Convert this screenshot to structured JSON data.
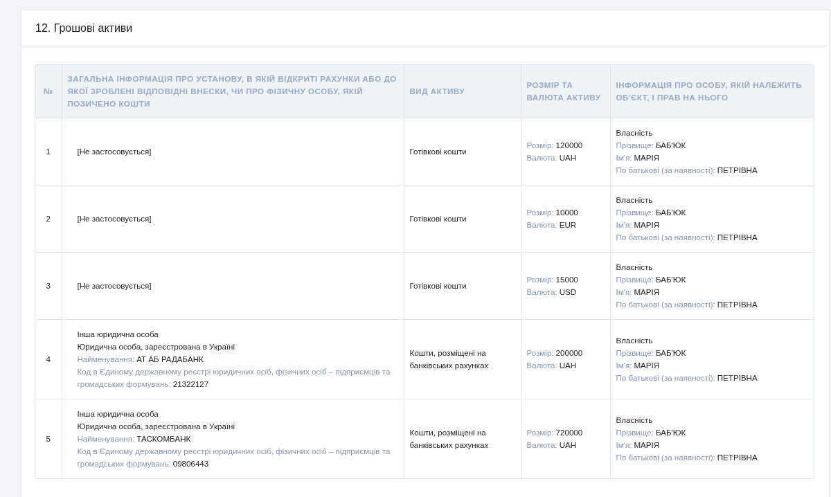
{
  "section": {
    "title": "12. Грошові активи"
  },
  "table": {
    "columns": [
      "№",
      "ЗАГАЛЬНА ІНФОРМАЦІЯ ПРО УСТАНОВУ, В ЯКІЙ ВІДКРИТІ РАХУНКИ АБО ДО ЯКОЇ ЗРОБЛЕНІ ВІДПОВІДНІ ВНЕСКИ, ЧИ ПРО ФІЗИЧНУ ОСОБУ, ЯКІЙ ПОЗИЧЕНО КОШТИ",
      "ВИД АКТИВУ",
      "РОЗМІР ТА ВАЛЮТА АКТИВУ",
      "ІНФОРМАЦІЯ ПРО ОСОБУ, ЯКІЙ НАЛЕЖИТЬ ОБ'ЄКТ, І ПРАВ НА НЬОГО"
    ],
    "rows": [
      {
        "number": "1",
        "institution": [
          {
            "value": "[Не застосовується]"
          }
        ],
        "asset_type": "Готівкові кошти",
        "amount": [
          {
            "label": "Розмір:",
            "value": "120000"
          },
          {
            "label": "Валюта:",
            "value": "UAH"
          }
        ],
        "owner": [
          {
            "value": "Власність"
          },
          {
            "label": "Прізвище:",
            "value": "БАБ'ЮК"
          },
          {
            "label": "Ім'я:",
            "value": "МАРІЯ"
          },
          {
            "label": "По батькові (за наявності):",
            "value": "ПЕТРІВНА"
          }
        ]
      },
      {
        "number": "2",
        "institution": [
          {
            "value": "[Не застосовується]"
          }
        ],
        "asset_type": "Готівкові кошти",
        "amount": [
          {
            "label": "Розмір:",
            "value": "10000"
          },
          {
            "label": "Валюта:",
            "value": "EUR"
          }
        ],
        "owner": [
          {
            "value": "Власність"
          },
          {
            "label": "Прізвище:",
            "value": "БАБ'ЮК"
          },
          {
            "label": "Ім'я:",
            "value": "МАРІЯ"
          },
          {
            "label": "По батькові (за наявності):",
            "value": "ПЕТРІВНА"
          }
        ]
      },
      {
        "number": "3",
        "institution": [
          {
            "value": "[Не застосовується]"
          }
        ],
        "asset_type": "Готівкові кошти",
        "amount": [
          {
            "label": "Розмір:",
            "value": "15000"
          },
          {
            "label": "Валюта:",
            "value": "USD"
          }
        ],
        "owner": [
          {
            "value": "Власність"
          },
          {
            "label": "Прізвище:",
            "value": "БАБ'ЮК"
          },
          {
            "label": "Ім'я:",
            "value": "МАРІЯ"
          },
          {
            "label": "По батькові (за наявності):",
            "value": "ПЕТРІВНА"
          }
        ]
      },
      {
        "number": "4",
        "institution": [
          {
            "value": "Інша юридична особа"
          },
          {
            "value": "Юридична особа, зареєстрована в Україні"
          },
          {
            "label": "Найменування:",
            "value": "АТ АБ РАДАБАНК"
          },
          {
            "label": "Код в Єдиному державному реєстрі юридичних осіб, фізичних осіб – підприємців та громадських формувань:",
            "value": "21322127"
          }
        ],
        "asset_type": "Кошти, розміщені на банківських рахунках",
        "amount": [
          {
            "label": "Розмір:",
            "value": "200000"
          },
          {
            "label": "Валюта:",
            "value": "UAH"
          }
        ],
        "owner": [
          {
            "value": "Власність"
          },
          {
            "label": "Прізвище:",
            "value": "БАБ'ЮК"
          },
          {
            "label": "Ім'я:",
            "value": "МАРІЯ"
          },
          {
            "label": "По батькові (за наявності):",
            "value": "ПЕТРІВНА"
          }
        ]
      },
      {
        "number": "5",
        "institution": [
          {
            "value": "Інша юридична особа"
          },
          {
            "value": "Юридична особа, зареєстрована в Україні"
          },
          {
            "label": "Найменування:",
            "value": "ТАСКОМБАНК"
          },
          {
            "label": "Код в Єдиному державному реєстрі юридичних осіб, фізичних осіб – підприємців та громадських формувань:",
            "value": "09806443"
          }
        ],
        "asset_type": "Кошти, розміщені на банківських рахунках",
        "amount": [
          {
            "label": "Розмір:",
            "value": "720000"
          },
          {
            "label": "Валюта:",
            "value": "UAH"
          }
        ],
        "owner": [
          {
            "value": "Власність"
          },
          {
            "label": "Прізвище:",
            "value": "БАБ'ЮК"
          },
          {
            "label": "Ім'я:",
            "value": "МАРІЯ"
          },
          {
            "label": "По батькові (за наявності):",
            "value": "ПЕТРІВНА"
          }
        ]
      }
    ]
  }
}
